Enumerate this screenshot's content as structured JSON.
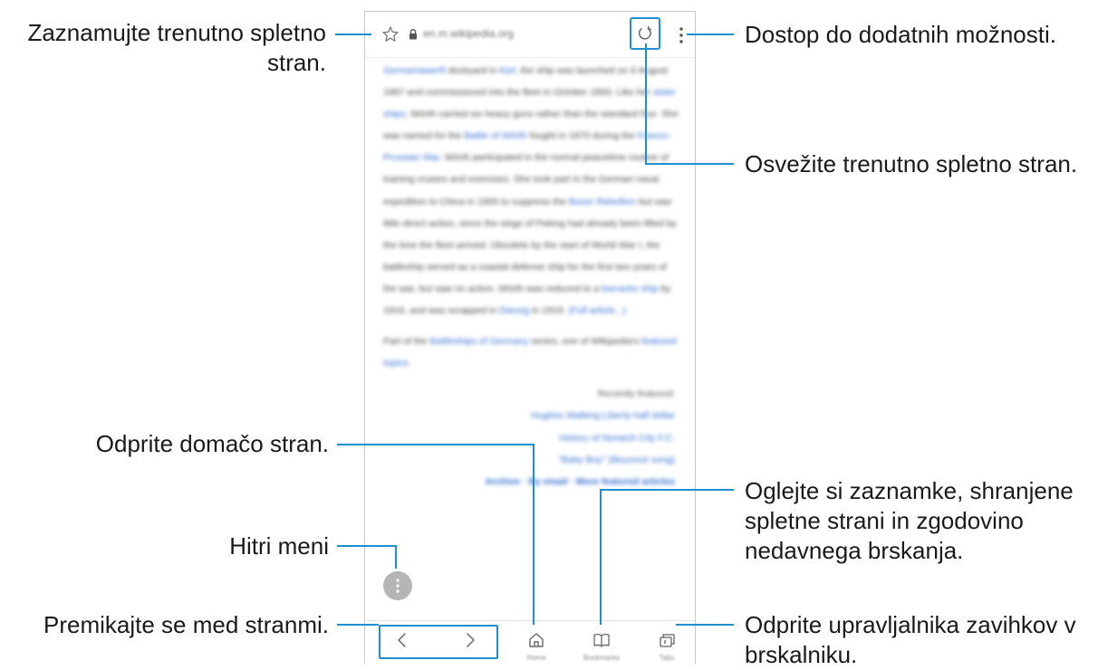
{
  "browser": {
    "url": "en.m.wikipedia.org",
    "article_paragraph_1": [
      {
        "t": "Germaniawerft",
        "link": true
      },
      {
        "t": " dockyard in ",
        "link": false
      },
      {
        "t": "Kiel",
        "link": true
      },
      {
        "t": ", the ship was launched on 6 August 1887 and commissioned into the fleet in October 1893. Like her ",
        "link": false
      },
      {
        "t": "sister ships",
        "link": true
      },
      {
        "t": ", Wörth carried six heavy guns rather than the standard four. She was named for the ",
        "link": false
      },
      {
        "t": "Battle of Wörth",
        "link": true
      },
      {
        "t": " fought in 1870 during the ",
        "link": false
      },
      {
        "t": "Franco-Prussian War",
        "link": true
      },
      {
        "t": ". Wörth participated in the normal peacetime routine of training cruises and exercises. She took part in the German naval expedition to China in 1900 to suppress the ",
        "link": false
      },
      {
        "t": "Boxer Rebellion",
        "link": true
      },
      {
        "t": " but saw little direct action, since the siege of Peking had already been lifted by the time the fleet arrived. Obsolete by the start of World War I, the battleship served as a coastal defense ship for the first two years of the war, but saw no action. Wörth was reduced to a ",
        "link": false
      },
      {
        "t": "barracks ship",
        "link": true
      },
      {
        "t": " by 1916, and was scrapped in ",
        "link": false
      },
      {
        "t": "Danzig",
        "link": true
      },
      {
        "t": " in 1919. ",
        "link": false
      },
      {
        "t": "(Full article...)",
        "link": true
      }
    ],
    "article_paragraph_2": [
      {
        "t": "Part of the ",
        "link": false
      },
      {
        "t": "Battleships of Germany",
        "link": true
      },
      {
        "t": " series, one of Wikipedia's ",
        "link": false
      },
      {
        "t": "featured topics",
        "link": true
      },
      {
        "t": ".",
        "link": false
      }
    ],
    "recently_featured_heading": "Recently featured:",
    "recently_featured": [
      "Hughes Walking Liberty half dollar",
      "History of Norwich City F.C.",
      "\"Baby Boy\" (Beyoncé song)"
    ],
    "archive_links": "Archive · By email · More featured articles",
    "bottom_labels": {
      "home": "Home",
      "bookmarks": "Bookmarks",
      "tabs": "Tabs"
    }
  },
  "callouts": {
    "bookmark": "Zaznamujte trenutno spletno\nstran.",
    "more_options": "Dostop do dodatnih možnosti.",
    "refresh": "Osvežite trenutno spletno stran.",
    "home": "Odprite domačo stran.",
    "bookmarks": "Oglejte si zaznamke, shranjene\nspletne strani in zgodovino\nnedavnega brskanja.",
    "quick_menu": "Hitri meni",
    "navigate": "Premikajte se med stranmi.",
    "tabs": "Odprite upravljalnika zavihkov v\nbrskalniku."
  },
  "colors": {
    "highlight": "#1f8fd0",
    "link": "#2e6ad0"
  },
  "icons": {
    "bookmark": "star-outline-icon",
    "lock": "lock-icon",
    "refresh": "refresh-icon",
    "more": "vertical-dots-icon",
    "back": "chevron-left-icon",
    "forward": "chevron-right-icon",
    "home": "home-icon",
    "bookmarks": "open-book-icon",
    "tabs": "tabs-icon"
  }
}
